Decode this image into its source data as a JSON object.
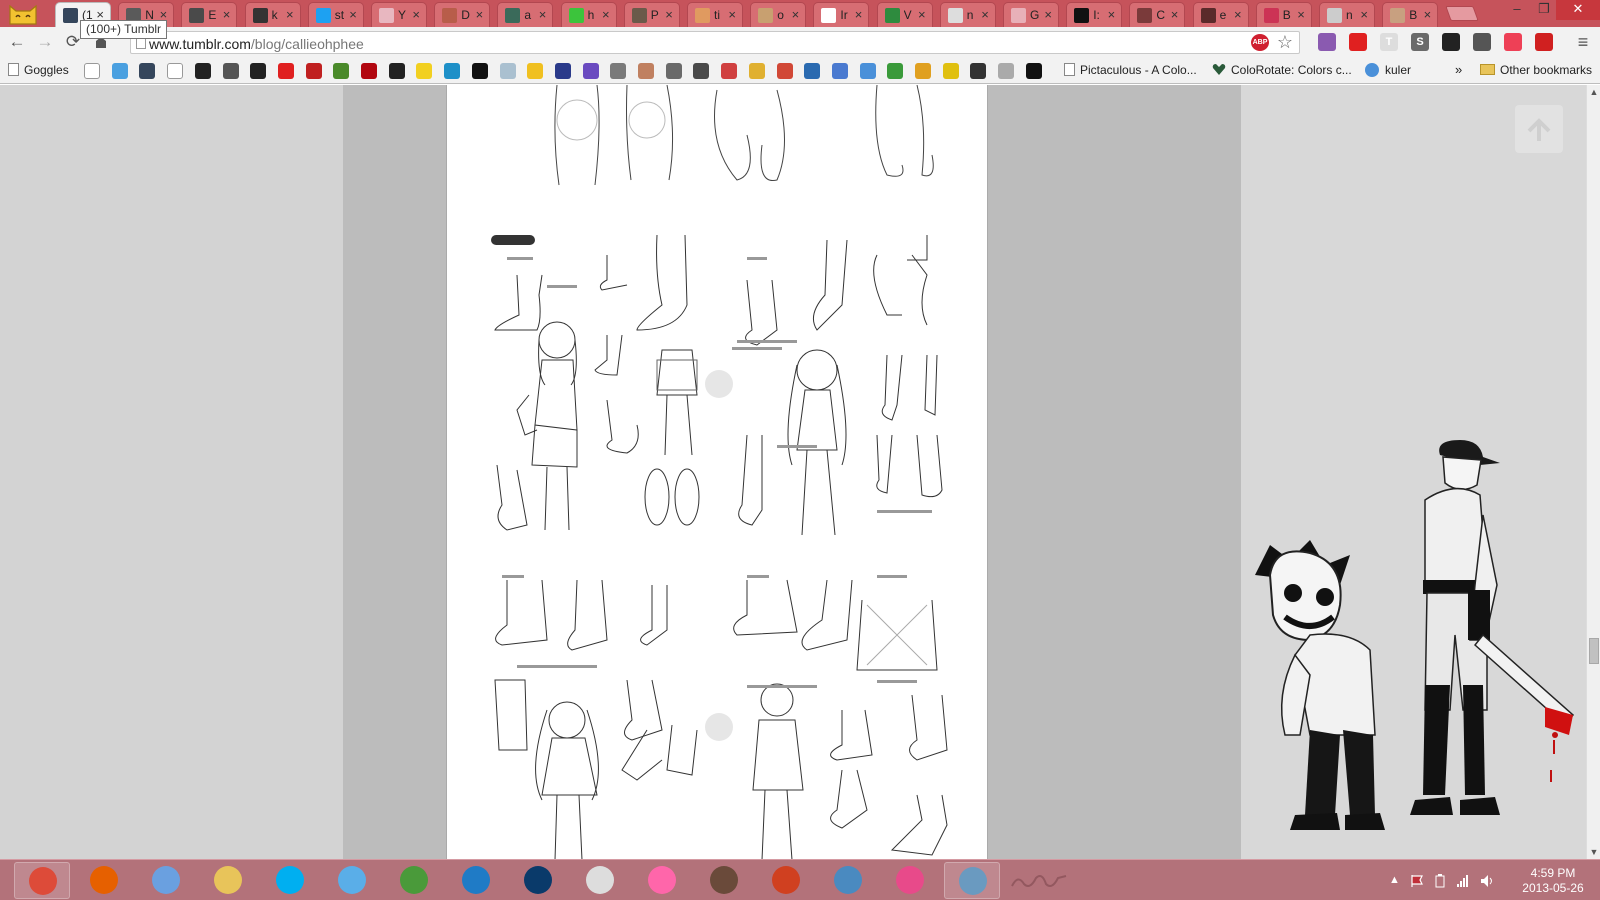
{
  "tabs": [
    {
      "label": "(1",
      "active": true,
      "color": "#35465c"
    },
    {
      "label": "N",
      "active": false,
      "color": "#5a5a5a"
    },
    {
      "label": "E",
      "active": false,
      "color": "#4a4a4a"
    },
    {
      "label": "k",
      "active": false,
      "color": "#333333"
    },
    {
      "label": "st",
      "active": false,
      "color": "#1da1f2"
    },
    {
      "label": "Y",
      "active": false,
      "color": "#e8b7c0"
    },
    {
      "label": "D",
      "active": false,
      "color": "#b85d4a"
    },
    {
      "label": "a",
      "active": false,
      "color": "#3a6a5a"
    },
    {
      "label": "h",
      "active": false,
      "color": "#3cc43c"
    },
    {
      "label": "P",
      "active": false,
      "color": "#6a5a4a"
    },
    {
      "label": "ti",
      "active": false,
      "color": "#e09a60"
    },
    {
      "label": "o",
      "active": false,
      "color": "#c8a070"
    },
    {
      "label": "Ir",
      "active": false,
      "color": "#ffffff"
    },
    {
      "label": "V",
      "active": false,
      "color": "#2e8b3e"
    },
    {
      "label": "n",
      "active": false,
      "color": "#dddddd"
    },
    {
      "label": "G",
      "active": false,
      "color": "#e8b0b8"
    },
    {
      "label": "I:",
      "active": false,
      "color": "#111111"
    },
    {
      "label": "C",
      "active": false,
      "color": "#7a3a3a"
    },
    {
      "label": "e",
      "active": false,
      "color": "#5a2a2a"
    },
    {
      "label": "B",
      "active": false,
      "color": "#cc3355"
    },
    {
      "label": "n",
      "active": false,
      "color": "#cccccc"
    },
    {
      "label": "B",
      "active": false,
      "color": "#c8a080"
    }
  ],
  "window_controls": {
    "minimize": "–",
    "restore": "❐",
    "close": "✕"
  },
  "tooltip": "(100+) Tumblr",
  "toolbar": {
    "back": "←",
    "forward": "→",
    "reload": "⟳",
    "url_host": "www.tumblr.com",
    "url_path": "/blog/callieohphee",
    "star": "☆",
    "menu": "≡"
  },
  "extensions": [
    {
      "name": "adblock",
      "color": "#d02030",
      "label": "ABP"
    },
    {
      "name": "ext-purple",
      "color": "#8a5ab0",
      "label": ""
    },
    {
      "name": "ext-red",
      "color": "#e02020",
      "label": ""
    },
    {
      "name": "ext-t",
      "color": "#dddddd",
      "label": "T"
    },
    {
      "name": "ext-s",
      "color": "#6a6a6a",
      "label": "S"
    },
    {
      "name": "ext-dark",
      "color": "#222222",
      "label": ""
    },
    {
      "name": "ext-eyedropper",
      "color": "#555555",
      "label": ""
    },
    {
      "name": "ext-pocket",
      "color": "#ee4056",
      "label": ""
    },
    {
      "name": "ext-k",
      "color": "#d02020",
      "label": ""
    }
  ],
  "bookmarks": {
    "first": "Goggles",
    "icons": [
      {
        "name": "page",
        "color": "#ffffff"
      },
      {
        "name": "feather",
        "color": "#4aa0e0"
      },
      {
        "name": "tumblr",
        "color": "#35465c"
      },
      {
        "name": "face",
        "color": "#ffffff"
      },
      {
        "name": "dark-blob",
        "color": "#222222"
      },
      {
        "name": "s-box",
        "color": "#555555"
      },
      {
        "name": "crossbones",
        "color": "#222222"
      },
      {
        "name": "youtube",
        "color": "#e02020"
      },
      {
        "name": "red-ball",
        "color": "#c02020"
      },
      {
        "name": "green-box",
        "color": "#4a8a2a"
      },
      {
        "name": "netflix",
        "color": "#b20710"
      },
      {
        "name": "paw",
        "color": "#222222"
      },
      {
        "name": "pikachu",
        "color": "#f2d020"
      },
      {
        "name": "p-box",
        "color": "#1e90c8"
      },
      {
        "name": "star",
        "color": "#111111"
      },
      {
        "name": "cat",
        "color": "#aac0d0"
      },
      {
        "name": "yellow-circle",
        "color": "#f0c020"
      },
      {
        "name": "z-box",
        "color": "#2a3a8a"
      },
      {
        "name": "bolt",
        "color": "#6a4ac0"
      },
      {
        "name": "ap",
        "color": "#7a7a7a"
      },
      {
        "name": "panda",
        "color": "#c08060"
      },
      {
        "name": "gray-box",
        "color": "#6a6a6a"
      },
      {
        "name": "dark-box",
        "color": "#4a4a4a"
      },
      {
        "name": "calendar",
        "color": "#d04040"
      },
      {
        "name": "yellow-bird",
        "color": "#e0b030"
      },
      {
        "name": "gmail",
        "color": "#d14836"
      },
      {
        "name": "drop",
        "color": "#2a6ab0"
      },
      {
        "name": "grid",
        "color": "#4a7ad0"
      },
      {
        "name": "globe",
        "color": "#4a90d9"
      },
      {
        "name": "green-blob",
        "color": "#3a9a3a"
      },
      {
        "name": "bird",
        "color": "#e0a020"
      },
      {
        "name": "coin",
        "color": "#e0c010"
      },
      {
        "name": "person",
        "color": "#333333"
      },
      {
        "name": "square",
        "color": "#aaaaaa"
      },
      {
        "name": "figure",
        "color": "#111111"
      }
    ],
    "named": [
      {
        "label": "Pictaculous - A Colo...",
        "icon": "page"
      },
      {
        "label": "ColoRotate: Colors c...",
        "icon": "heart"
      },
      {
        "label": "kuler",
        "icon": "kuler"
      }
    ],
    "overflow": "»",
    "other": "Other bookmarks"
  },
  "content": {
    "art_sections": [
      "top-feet-sketches",
      "shoes-sheet",
      "sneakers-sheet"
    ]
  },
  "taskbar": {
    "apps": [
      {
        "name": "chrome",
        "color": "#dd4b39",
        "pinned": true
      },
      {
        "name": "firefox",
        "color": "#e66000",
        "pinned": false
      },
      {
        "name": "paint",
        "color": "#6aa0e0",
        "pinned": false
      },
      {
        "name": "explorer",
        "color": "#e8c45a",
        "pinned": false
      },
      {
        "name": "skype",
        "color": "#00aff0",
        "pinned": false
      },
      {
        "name": "itunes",
        "color": "#5aaee8",
        "pinned": false
      },
      {
        "name": "globe-app",
        "color": "#4a9a3a",
        "pinned": false
      },
      {
        "name": "pse",
        "color": "#1f7bc6",
        "pinned": false
      },
      {
        "name": "photoshop",
        "color": "#0a3a6a",
        "pinned": false
      },
      {
        "name": "notepad",
        "color": "#dddddd",
        "pinned": false
      },
      {
        "name": "osu",
        "color": "#ff66aa",
        "pinned": false
      },
      {
        "name": "game-char",
        "color": "#6a4a3a",
        "pinned": false
      },
      {
        "name": "mushroom",
        "color": "#d04020",
        "pinned": false
      },
      {
        "name": "ghost",
        "color": "#4a8ac0",
        "pinned": false
      },
      {
        "name": "paint-tool",
        "color": "#e84a8a",
        "pinned": false
      },
      {
        "name": "control-panel",
        "color": "#6a9ac0",
        "pinned": true
      }
    ],
    "clock_time": "4:59 PM",
    "clock_date": "2013-05-26",
    "tray": [
      "show-hidden-icon",
      "flag-icon",
      "power-icon",
      "signal-icon",
      "volume-icon"
    ]
  }
}
